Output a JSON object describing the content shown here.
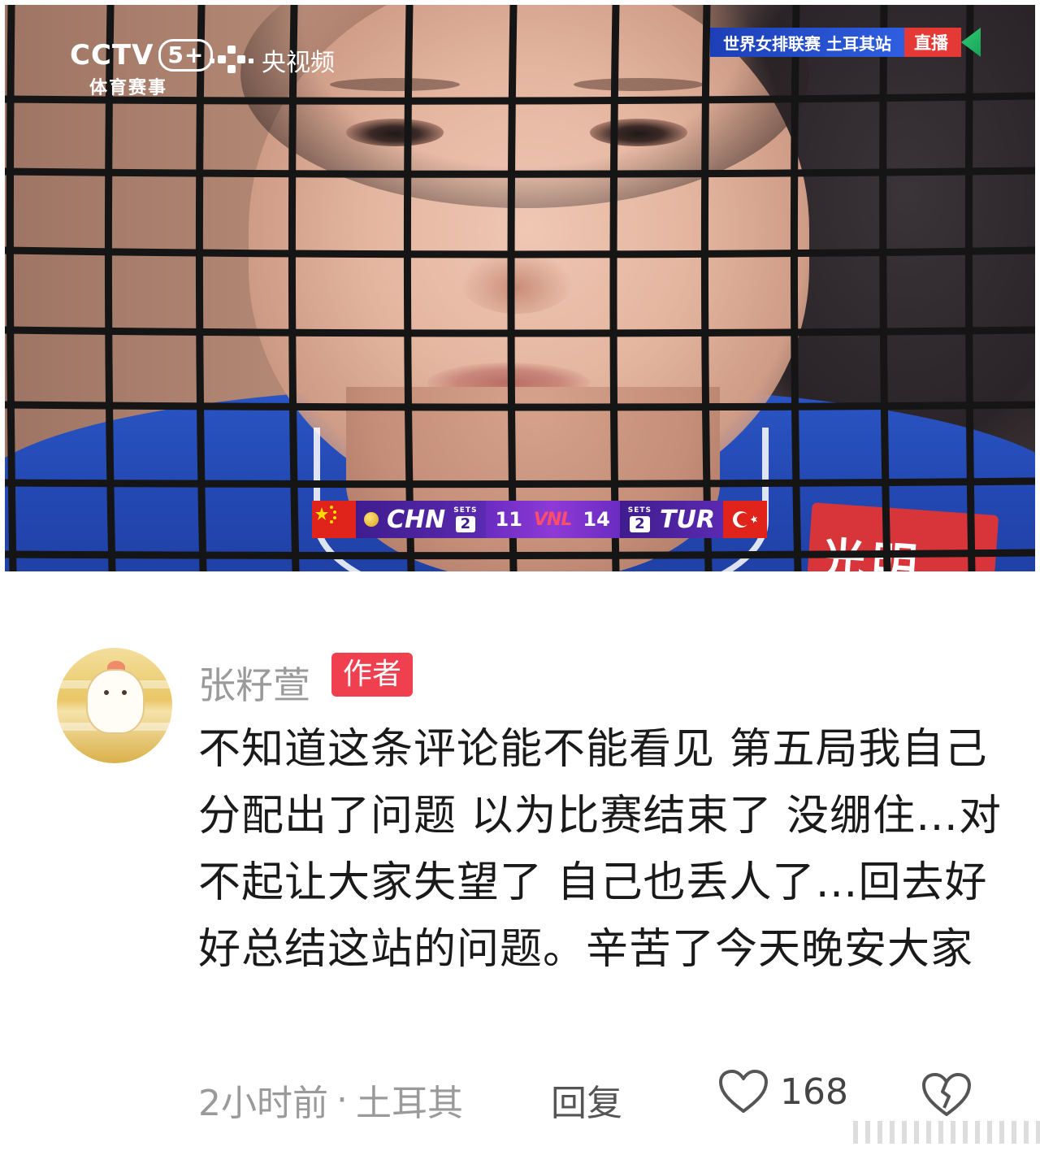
{
  "video": {
    "logo_main": "CCTV",
    "logo_badge": "5+",
    "logo_sub": "体育赛事",
    "app_name": "央视频",
    "live_title": "世界女排联赛 土耳其站",
    "live_tag": "直播",
    "jersey_text": "光明",
    "scoreboard": {
      "home_team": "CHN",
      "home_sets_label": "SETS",
      "home_sets": "2",
      "home_points": "11",
      "league": "VNL",
      "away_points": "14",
      "away_sets_label": "SETS",
      "away_sets": "2",
      "away_team": "TUR"
    }
  },
  "comment": {
    "username": "张籽萱",
    "author_badge": "作者",
    "text": "不知道这条评论能不能看见 第五局我自己分配出了问题 以为比赛结束了 没绷住…对不起让大家失望了 自己也丢人了…回去好好总结这站的问题。辛苦了今天晚安大家",
    "time": "2小时前",
    "location": "土耳其",
    "reply_label": "回复",
    "like_count": "168"
  },
  "colors": {
    "badge_red": "#f04050",
    "jersey_blue": "#2449b4",
    "scoreboard_purple": "#5a2ab0"
  }
}
